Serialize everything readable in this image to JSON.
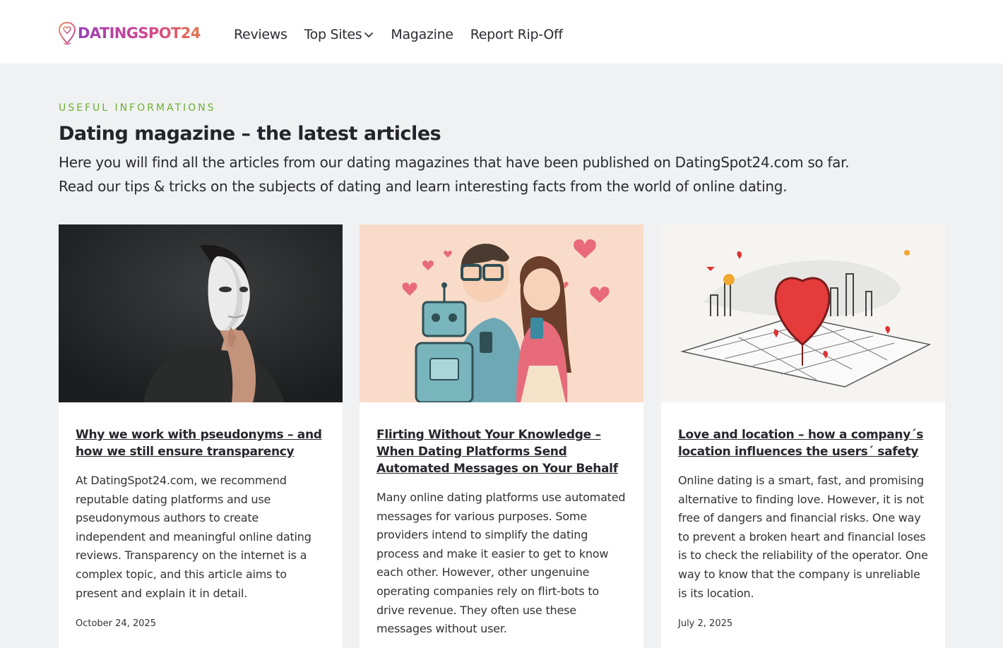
{
  "header": {
    "logo_text": "DATINGSPOT24",
    "nav": [
      {
        "label": "Reviews"
      },
      {
        "label": "Top Sites",
        "has_dropdown": true
      },
      {
        "label": "Magazine"
      },
      {
        "label": "Report Rip-Off"
      }
    ]
  },
  "section": {
    "eyebrow": "USEFUL INFORMATIONS",
    "title": "Dating magazine – the latest articles",
    "intro_line1": "Here you will find all the articles from our dating magazines that have been published on DatingSpot24.com so far.",
    "intro_line2": "Read our tips & tricks on the subjects of dating and learn interesting facts from the world of online dating."
  },
  "articles": [
    {
      "image": "man-with-white-mask",
      "title": "Why we work with pseudonyms – and how we still ensure transparency",
      "excerpt": "At DatingSpot24.com, we recommend reputable dating platforms and use pseudonymous authors to create independent and meaningful online dating reviews. Transparency on the internet is a complex topic, and this article aims to present and explain it in detail.",
      "date": "October 24, 2025"
    },
    {
      "image": "robot-and-couple-with-phones",
      "title": "Flirting Without Your Knowledge – When Dating Platforms Send Automated Messages on Your Behalf",
      "excerpt": "Many online dating platforms use automated messages for various purposes. Some providers intend to simplify the dating process and make it easier to get to know each other. However, other ungenuine operating companies rely on flirt-bots to drive revenue. They often use these messages without user.",
      "date": ""
    },
    {
      "image": "heart-over-city-map",
      "title": "Love and location – how a company´s location influences the users´ safety",
      "excerpt": "Online dating is a smart, fast, and promising alternative to finding love. However, it is not free of dangers and financial risks. One way to prevent a broken heart and financial loses is to check the reliability of the operator. One way to know that the company is unreliable is its location.",
      "date": "July 2, 2025"
    }
  ],
  "colors": {
    "accent_green": "#6ab22e",
    "page_bg": "#f0f1f3",
    "logo_gradient_start": "#9b3fb8",
    "logo_gradient_end": "#e6734d"
  }
}
